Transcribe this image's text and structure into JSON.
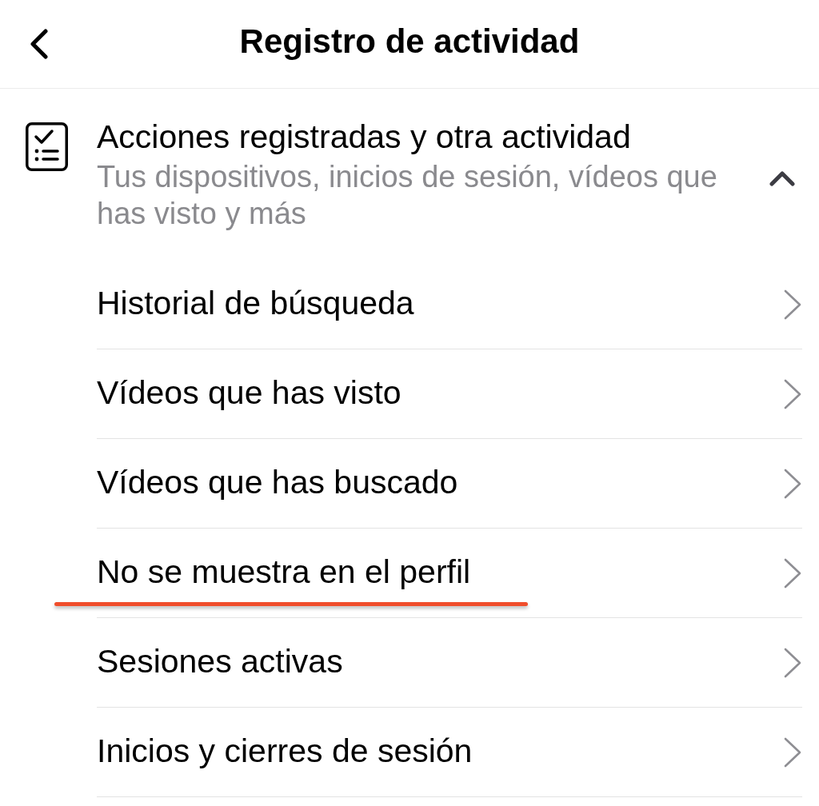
{
  "header": {
    "title": "Registro de actividad"
  },
  "section": {
    "title": "Acciones registradas y otra actividad",
    "subtitle": "Tus dispositivos, inicios de sesión, vídeos que has visto y más",
    "expanded": true
  },
  "items": [
    {
      "label": "Historial de búsqueda",
      "highlighted": false
    },
    {
      "label": "Vídeos que has visto",
      "highlighted": false
    },
    {
      "label": "Vídeos que has buscado",
      "highlighted": false
    },
    {
      "label": "No se muestra en el perfil",
      "highlighted": true
    },
    {
      "label": "Sesiones activas",
      "highlighted": false
    },
    {
      "label": "Inicios y cierres de sesión",
      "highlighted": false
    }
  ]
}
